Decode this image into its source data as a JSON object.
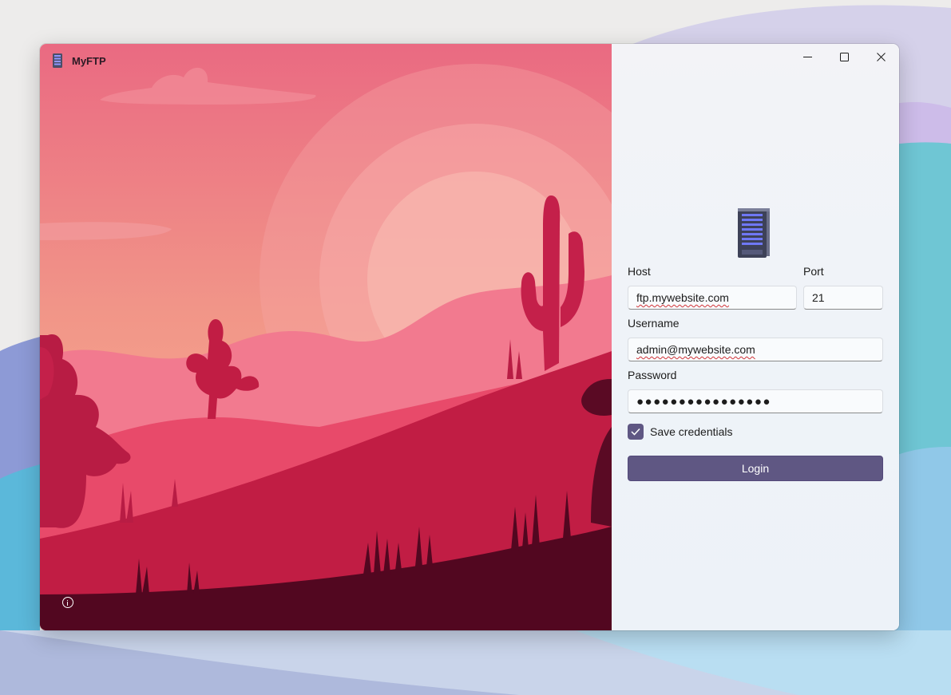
{
  "app": {
    "title": "MyFTP"
  },
  "window_controls": {
    "minimize_icon": "minimize-icon",
    "maximize_icon": "maximize-icon",
    "close_icon": "close-icon"
  },
  "form": {
    "host_label": "Host",
    "host_value": "ftp.mywebsite.com",
    "port_label": "Port",
    "port_value": "21",
    "username_label": "Username",
    "username_value": "admin@mywebsite.com",
    "password_label": "Password",
    "password_value": "●●●●●●●●●●●●●●●●",
    "save_label": "Save credentials",
    "save_checked": true,
    "login_label": "Login"
  },
  "colors": {
    "accent": "#5f5783",
    "hero_sky_top": "#e96b83",
    "hero_ground": "#520720"
  }
}
